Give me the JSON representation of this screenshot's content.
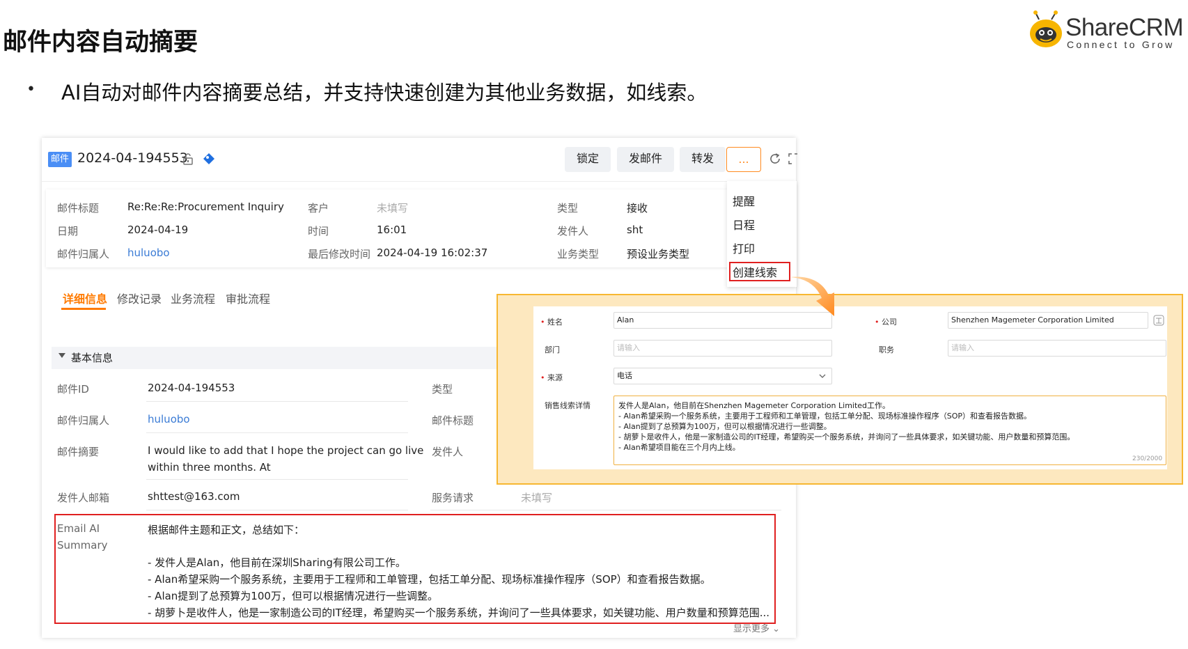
{
  "slide": {
    "title": "邮件内容自动摘要",
    "bullet": "•",
    "bullet_text": "AI自动对邮件内容摘要总结，并支持快速创建为其他业务数据，如线索。"
  },
  "logo": {
    "name": "ShareCRM",
    "tagline": "Connect to Grow"
  },
  "record": {
    "badge": "邮件",
    "id": "2024-04-194553",
    "buttons": {
      "lock": "锁定",
      "send": "发邮件",
      "forward": "转发",
      "more": "..."
    }
  },
  "info": {
    "subject_label": "邮件标题",
    "subject_value": "Re:Re:Re:Procurement Inquiry",
    "customer_label": "客户",
    "customer_value": "未填写",
    "type_label": "类型",
    "type_value": "接收",
    "date_label": "日期",
    "date_value": "2024-04-19",
    "time_label": "时间",
    "time_value": "16:01",
    "sender_label": "发件人",
    "sender_value": "sht",
    "owner_label": "邮件归属人",
    "owner_value": "huluobo",
    "modified_label": "最后修改时间",
    "modified_value": "2024-04-19 16:02:37",
    "biztype_label": "业务类型",
    "biztype_value": "预设业务类型"
  },
  "dropdown": {
    "items": [
      "提醒",
      "日程",
      "打印",
      "创建线索"
    ]
  },
  "tabs": [
    "详细信息",
    "修改记录",
    "业务流程",
    "审批流程"
  ],
  "section": {
    "title": "基本信息"
  },
  "details": {
    "mail_id_label": "邮件ID",
    "mail_id_value": "2024-04-194553",
    "type_label": "类型",
    "owner_label": "邮件归属人",
    "owner_value": "huluobo",
    "subject_label": "邮件标题",
    "summary_label": "邮件摘要",
    "summary_line1": "I would like to add that I hope the project can go live",
    "summary_line2": "within three months. At",
    "sender_label": "发件人",
    "sender_email_label": "发件人邮箱",
    "sender_email_value": "shttest@163.com",
    "service_label": "服务请求",
    "service_value": "未填写"
  },
  "ai_summary": {
    "label_line1": "Email AI",
    "label_line2": "Summary",
    "lines": [
      "根据邮件主题和正文，总结如下：",
      "- 发件人是Alan，他目前在深圳Sharing有限公司工作。",
      "- Alan希望采购一个服务系统，主要用于工程师和工单管理，包括工单分配、现场标准操作程序（SOP）和查看报告数据。",
      "- Alan提到了总预算为100万，但可以根据情况进行一些调整。",
      "- 胡萝卜是收件人，他是一家制造公司的IT经理，希望购买一个服务系统，并询问了一些具体要求，如关键功能、用户数量和预算范围..."
    ],
    "show_more": "显示更多"
  },
  "lead_form": {
    "name_label": "姓名",
    "name_value": "Alan",
    "company_label": "公司",
    "company_value": "Shenzhen Magemeter Corporation Limited",
    "dept_label": "部门",
    "dept_placeholder": "请输入",
    "title_label": "职务",
    "title_placeholder": "请输入",
    "source_label": "来源",
    "source_value": "电话",
    "detail_label": "销售线索详情",
    "detail_lines": [
      "发件人是Alan，他目前在Shenzhen Magemeter Corporation Limited工作。",
      "- Alan希望采购一个服务系统，主要用于工程师和工单管理，包括工单分配、现场标准操作程序（SOP）和查看报告数据。",
      "- Alan提到了总预算为100万，但可以根据情况进行一些调整。",
      "- 胡萝卜是收件人，他是一家制造公司的IT经理，希望购买一个服务系统，并询问了一些具体要求，如关键功能、用户数量和预算范围。",
      "- Alan希望项目能在三个月内上线。"
    ],
    "counter": "230/2000"
  },
  "colors": {
    "accent": "#ff7a00",
    "badge": "#4a8ef5",
    "highlight": "#e02020",
    "link": "#3a7bd5",
    "overlay": "#fde8bf"
  }
}
